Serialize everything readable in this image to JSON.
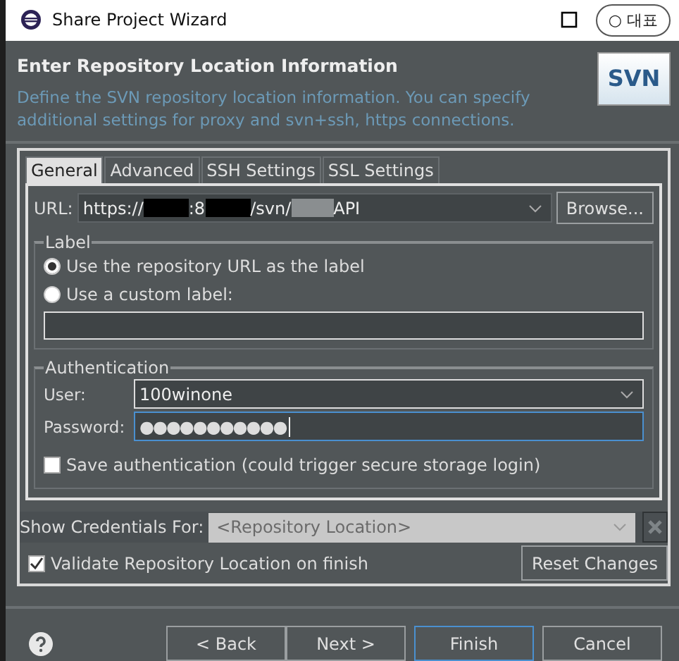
{
  "window": {
    "title": "Share Project Wizard",
    "badge": "○ 대표"
  },
  "header": {
    "title": "Enter Repository Location Information",
    "description": "Define the SVN repository location information. You can specify additional settings for proxy and svn+ssh, https connections.",
    "logo": "SVN"
  },
  "tabs": [
    {
      "label": "General",
      "selected": true
    },
    {
      "label": "Advanced",
      "selected": false
    },
    {
      "label": "SSH Settings",
      "selected": false
    },
    {
      "label": "SSL Settings",
      "selected": false
    }
  ],
  "url": {
    "label": "URL:",
    "segments": [
      {
        "kind": "text",
        "text": "https://"
      },
      {
        "kind": "blackout"
      },
      {
        "kind": "text",
        "text": ":8"
      },
      {
        "kind": "blackout"
      },
      {
        "kind": "text",
        "text": "/svn/"
      },
      {
        "kind": "blur"
      },
      {
        "kind": "text",
        "text": "API"
      }
    ],
    "browse": "Browse..."
  },
  "label_group": {
    "title": "Label",
    "options": [
      {
        "label": "Use the repository URL as the label",
        "selected": true
      },
      {
        "label": "Use a custom label:",
        "selected": false
      }
    ]
  },
  "auth": {
    "title": "Authentication",
    "user_label": "User:",
    "user": "100winone",
    "password_label": "Password:",
    "password": "●●●●●●●●●●●",
    "save": {
      "label": "Save authentication (could trigger secure storage login)",
      "checked": false
    }
  },
  "credentials": {
    "label": "Show Credentials For:",
    "value": "<Repository Location>",
    "disabled": true
  },
  "validate": {
    "label": "Validate Repository Location on finish",
    "checked": true
  },
  "reset": "Reset Changes",
  "buttons": [
    {
      "label": "< Back",
      "focused": false
    },
    {
      "label": "Next >",
      "focused": false
    },
    {
      "label": "Finish",
      "focused": true
    },
    {
      "label": "Cancel",
      "focused": false
    }
  ]
}
